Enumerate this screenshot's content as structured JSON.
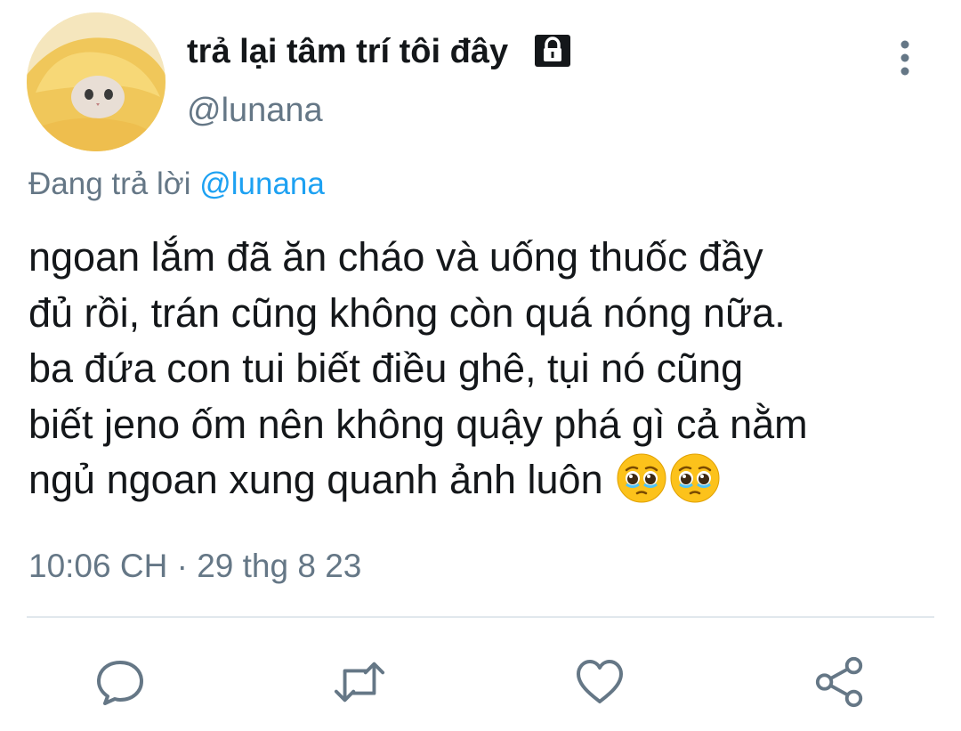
{
  "tweet": {
    "display_name": "trả lại tâm trí tôi đây",
    "handle": "@lunana",
    "reply_prefix": "Đang trả lời",
    "reply_mention": "@lunana",
    "text": "ngoan lắm đã ăn cháo và uống thuốc đầy\nđủ rồi, trán cũng không còn quá nóng nữa.\nba đứa con tui biết điều ghê, tụi nó cũng\nbiết jeno ốm nên không quậy phá gì cả nằm\nngủ ngoan xung quanh ảnh luôn",
    "emojis": [
      "🥹",
      "🥹"
    ],
    "timestamp": "10:06 CH · 29 thg 8 23"
  },
  "icons": {
    "lock": "lock-icon",
    "more": "more-vertical-icon",
    "reply": "comment-icon",
    "retweet": "retweet-icon",
    "like": "heart-icon",
    "share": "share-icon"
  },
  "colors": {
    "text": "#14171a",
    "secondary": "#657786",
    "accent": "#1da1f2",
    "divider": "#e1e8ed"
  }
}
